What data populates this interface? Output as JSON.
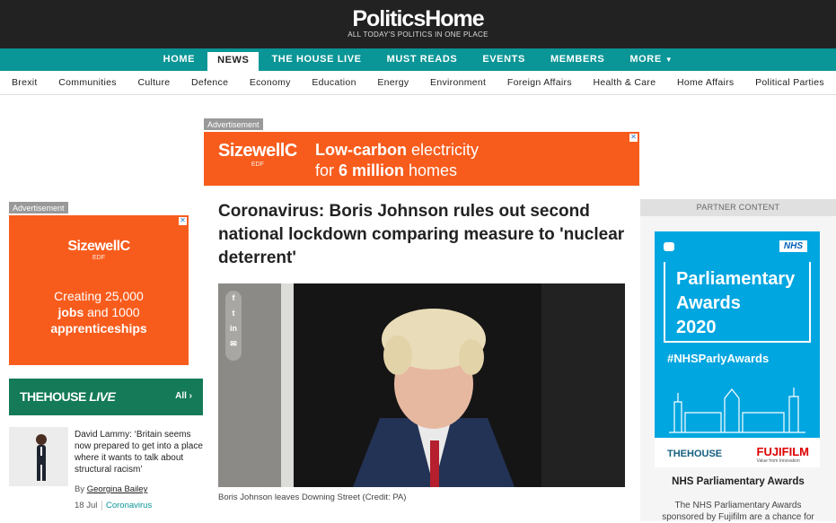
{
  "header": {
    "logo": "PoliticsHome",
    "tagline": "ALL TODAY'S POLITICS IN ONE PLACE"
  },
  "main_nav": [
    {
      "label": "HOME"
    },
    {
      "label": "NEWS",
      "active": true
    },
    {
      "label": "THE HOUSE LIVE"
    },
    {
      "label": "MUST READS"
    },
    {
      "label": "EVENTS"
    },
    {
      "label": "MEMBERS"
    },
    {
      "label": "MORE"
    }
  ],
  "sub_nav": [
    "Brexit",
    "Communities",
    "Culture",
    "Defence",
    "Economy",
    "Education",
    "Energy",
    "Environment",
    "Foreign Affairs",
    "Health & Care",
    "Home Affairs",
    "Political Parties"
  ],
  "top_ad": {
    "label": "Advertisement",
    "brand": "SizewellC",
    "brand_sub": "EDF",
    "line1_bold": "Low-carbon",
    "line1_rest": " electricity",
    "line2_pre": "for ",
    "line2_bold": "6 million",
    "line2_post": " homes"
  },
  "left_ad": {
    "label": "Advertisement",
    "brand": "SizewellC",
    "brand_sub": "EDF",
    "line1": "Creating 25,000",
    "line2_bold": "jobs",
    "line2_rest": " and 1000",
    "line3_bold": "apprenticeships"
  },
  "house_live": {
    "title_a": "THEHOUSE",
    "title_b": "LIVE",
    "all_label": "All"
  },
  "story": {
    "headline": "David Lammy: ‘Britain seems now prepared to get into a place where it wants to talk about structural racism’",
    "by": "By ",
    "author": "Georgina Bailey",
    "date": "18 Jul",
    "category": "Coronavirus"
  },
  "article": {
    "title": "Coronavirus: Boris Johnson rules out second national lockdown comparing measure to 'nuclear deterrent'",
    "caption": "Boris Johnson leaves Downing Street (Credit: PA)",
    "share": [
      "f",
      "t",
      "in",
      "✉"
    ]
  },
  "partner": {
    "header": "PARTNER CONTENT",
    "nhs_logo": "NHS",
    "banner_lines": [
      "Parliamentary",
      "Awards",
      "2020"
    ],
    "hashtag": "#NHSParlyAwards",
    "the_house": "THEHOUSE",
    "sponsor": "FUJIFILM",
    "sponsor_sub": "Value from Innovation",
    "title": "NHS Parliamentary Awards",
    "text": "The NHS Parliamentary Awards sponsored by Fujifilm are a chance for"
  },
  "colors": {
    "nav_teal": "#0a9596",
    "ad_orange": "#f85c1c",
    "house_green": "#147a58",
    "nhs_blue": "#00a6e0"
  }
}
